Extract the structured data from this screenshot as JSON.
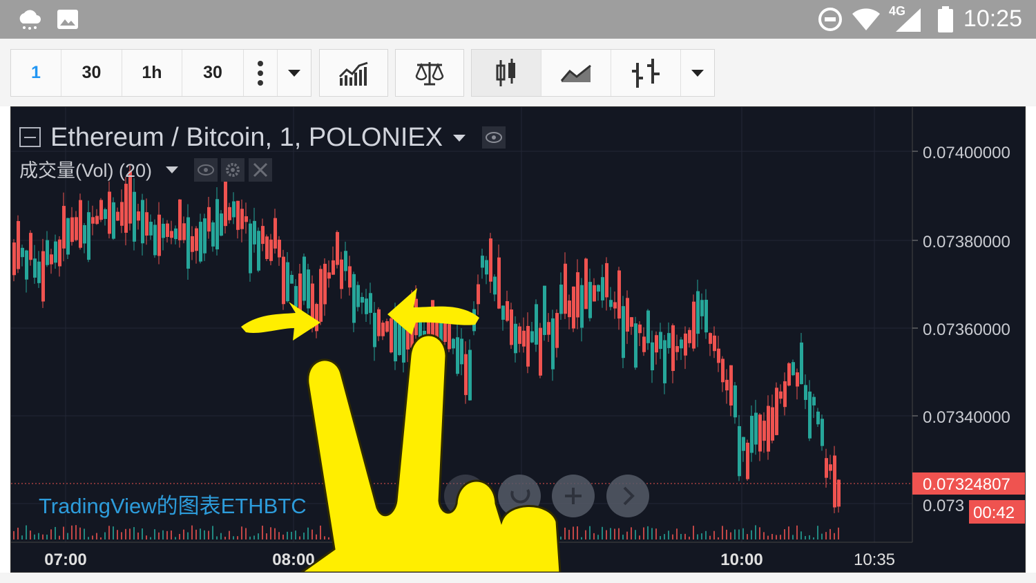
{
  "status_bar": {
    "time": "10:25",
    "network": "4G",
    "left_icons": [
      "weather-cloud-icon",
      "image-icon"
    ],
    "right_icons": [
      "do-not-disturb-icon",
      "wifi-icon",
      "cell-signal-icon",
      "battery-icon"
    ]
  },
  "toolbar": {
    "interval_buttons": [
      {
        "label": "1",
        "active": true
      },
      {
        "label": "30",
        "active": false
      },
      {
        "label": "1h",
        "active": false
      },
      {
        "label": "30",
        "active": false
      }
    ],
    "more_icon": "vertical-dots-icon",
    "interval_dropdown_icon": "dropdown-arrow-icon",
    "indicators_icon": "indicators-icon",
    "compare_icon": "balance-scale-icon",
    "chart_styles": [
      "candles-icon",
      "line-chart-icon",
      "bars-icon"
    ],
    "style_dropdown_icon": "dropdown-arrow-icon"
  },
  "chart": {
    "symbol_title": "Ethereum / Bitcoin, 1, POLONIEX",
    "volume_label": "成交量(Vol) (20)",
    "watermark": "TradingView的图表ETHBTC",
    "current_price": "0.07324807",
    "countdown": "00:42",
    "partial_price_label": "0.073",
    "colors": {
      "background": "#131722",
      "up": "#26a69a",
      "down": "#ef5350",
      "price_line": "#ef5350",
      "grid": "#232735",
      "axis_text": "#c9cbd1"
    }
  },
  "chart_data": {
    "type": "candlestick",
    "symbol": "ETHBTC",
    "exchange": "POLONIEX",
    "interval": "1",
    "ylim": [
      0.0731,
      0.0741
    ],
    "y_ticks": [
      "0.07400000",
      "0.07380000",
      "0.07360000",
      "0.07340000"
    ],
    "x_ticks": [
      "07:00",
      "08:00",
      "10:00",
      "10:35"
    ],
    "last_price": 0.07324807,
    "grid": true
  },
  "nav_buttons": [
    {
      "name": "reset-button",
      "icon": "reset-icon"
    },
    {
      "name": "zoom-in-button",
      "icon": "plus-icon"
    },
    {
      "name": "scroll-right-button",
      "icon": "chevron-right-icon"
    }
  ]
}
